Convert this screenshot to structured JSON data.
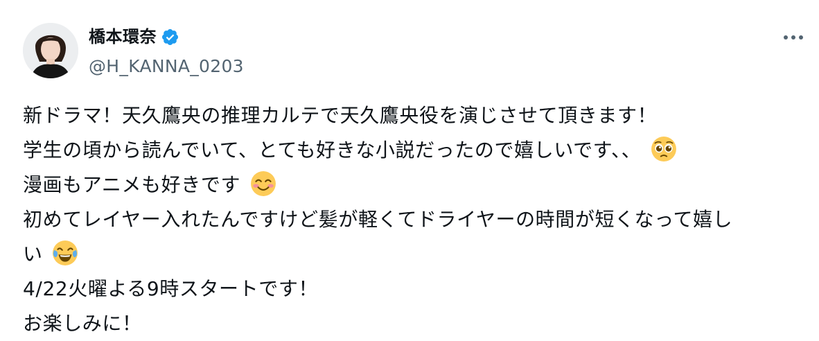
{
  "author": {
    "display_name": "橋本環奈",
    "handle": "@H_KANNA_0203",
    "verified": true,
    "verified_color": "#1d9bf0"
  },
  "menu": {
    "more_icon": "more-dots-icon"
  },
  "tweet": {
    "line1": "新ドラマ！天久鷹央の推理カルテで天久鷹央役を演じさせて頂きます！",
    "line2": "学生の頃から読んでいて、とても好きな小説だったので嬉しいです、、",
    "line2_emoji": "pleading-face-emoji",
    "line3": "漫画もアニメも好きです",
    "line3_emoji": "smiling-face-emoji",
    "line4": "初めてレイヤー入れたんですけど髪が軽くてドライヤーの時間が短くなって嬉し",
    "line5": "い",
    "line5_emoji": "tears-of-joy-emoji",
    "line6": "4/22火曜よる9時スタートです！",
    "line7": "お楽しみに！"
  },
  "colors": {
    "text": "#0f1419",
    "secondary": "#536471"
  }
}
